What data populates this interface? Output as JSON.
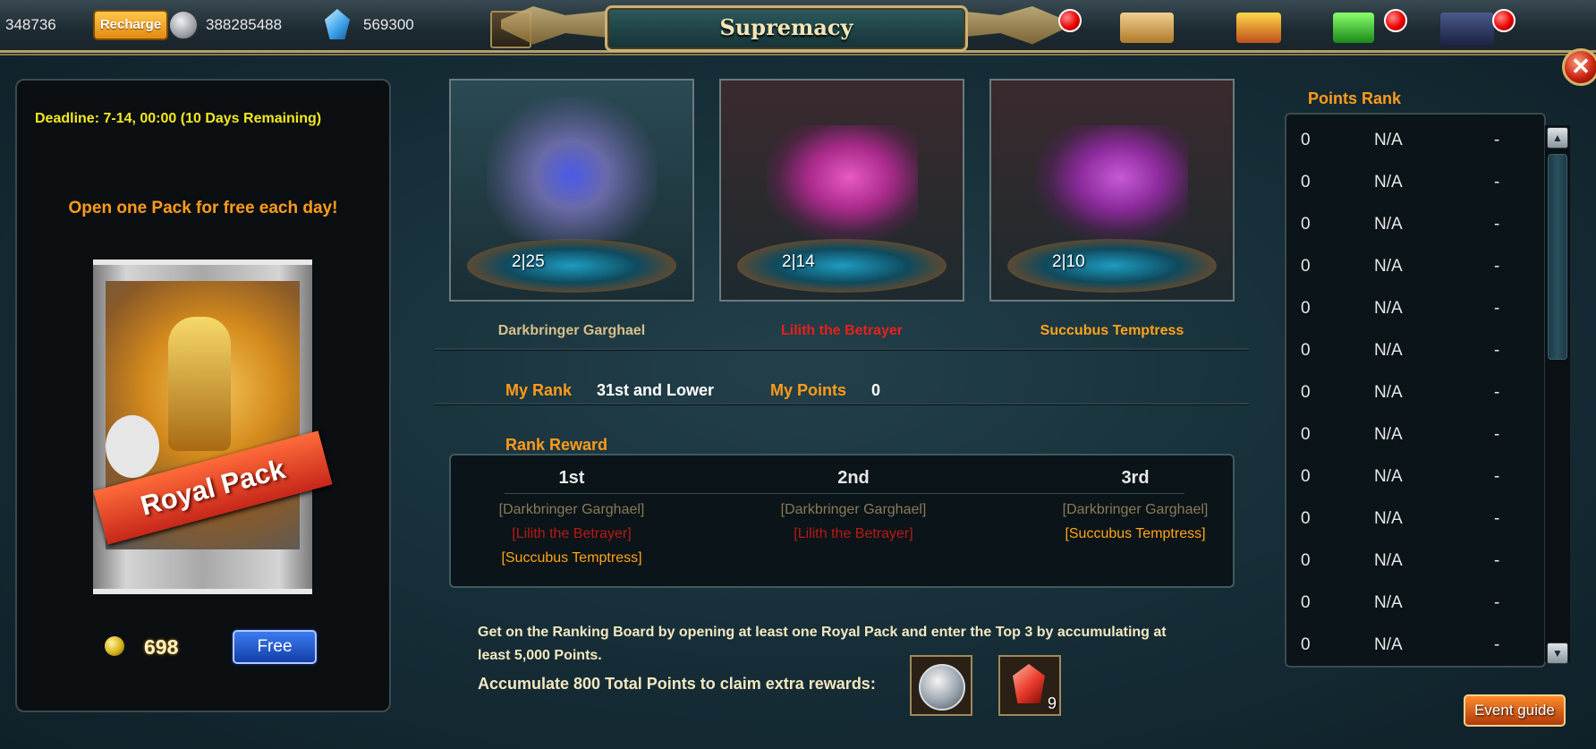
{
  "resources": {
    "value_1": "348736",
    "recharge_label": "Recharge",
    "silver": "388285488",
    "crystals": "569300"
  },
  "title": "Supremacy",
  "deadline": "Deadline: 7-14, 00:00 (10 Days Remaining)",
  "free_daily_text": "Open one Pack for free each day!",
  "pack_name": "Royal Pack",
  "pack_price": "698",
  "free_button": "Free",
  "heroes": [
    {
      "name": "Darkbringer Garghael",
      "count": "2|25",
      "color": "#d8c08a"
    },
    {
      "name": "Lilith the Betrayer",
      "count": "2|14",
      "color": "#e8201a"
    },
    {
      "name": "Succubus Temptress",
      "count": "2|10",
      "color": "#ffa31a"
    }
  ],
  "my_rank_label": "My Rank",
  "my_rank_value": "31st and Lower",
  "my_points_label": "My Points",
  "my_points_value": "0",
  "rank_reward_title": "Rank Reward",
  "rank_rewards": [
    {
      "place": "1st",
      "items": [
        "[Darkbringer Garghael]",
        "[Lilith the Betrayer]",
        "[Succubus Temptress]"
      ]
    },
    {
      "place": "2nd",
      "items": [
        "[Darkbringer Garghael]",
        "[Lilith the Betrayer]"
      ]
    },
    {
      "place": "3rd",
      "items": [
        "[Darkbringer Garghael]",
        "[Succubus Temptress]"
      ]
    }
  ],
  "info_line_1": "Get on the Ranking Board by opening at least one Royal Pack and enter the Top 3 by accumulating at",
  "info_line_2": "least 5,000 Points.",
  "info_line_3": "Accumulate 800 Total Points to claim extra rewards:",
  "extra_reward_gem_count": "9",
  "points_rank_title": "Points Rank",
  "points_rank_rows": [
    {
      "points": "0",
      "name": "N/A",
      "rank": "-"
    },
    {
      "points": "0",
      "name": "N/A",
      "rank": "-"
    },
    {
      "points": "0",
      "name": "N/A",
      "rank": "-"
    },
    {
      "points": "0",
      "name": "N/A",
      "rank": "-"
    },
    {
      "points": "0",
      "name": "N/A",
      "rank": "-"
    },
    {
      "points": "0",
      "name": "N/A",
      "rank": "-"
    },
    {
      "points": "0",
      "name": "N/A",
      "rank": "-"
    },
    {
      "points": "0",
      "name": "N/A",
      "rank": "-"
    },
    {
      "points": "0",
      "name": "N/A",
      "rank": "-"
    },
    {
      "points": "0",
      "name": "N/A",
      "rank": "-"
    },
    {
      "points": "0",
      "name": "N/A",
      "rank": "-"
    },
    {
      "points": "0",
      "name": "N/A",
      "rank": "-"
    },
    {
      "points": "0",
      "name": "N/A",
      "rank": "-"
    }
  ],
  "event_guide_label": "Event guide",
  "colors": {
    "accent_orange": "#ff9c1a",
    "deadline_yellow": "#f3e81e",
    "lilith_red": "#e8201a",
    "succubus_orange": "#ffa31a",
    "garghael_tan": "#d8c08a"
  }
}
